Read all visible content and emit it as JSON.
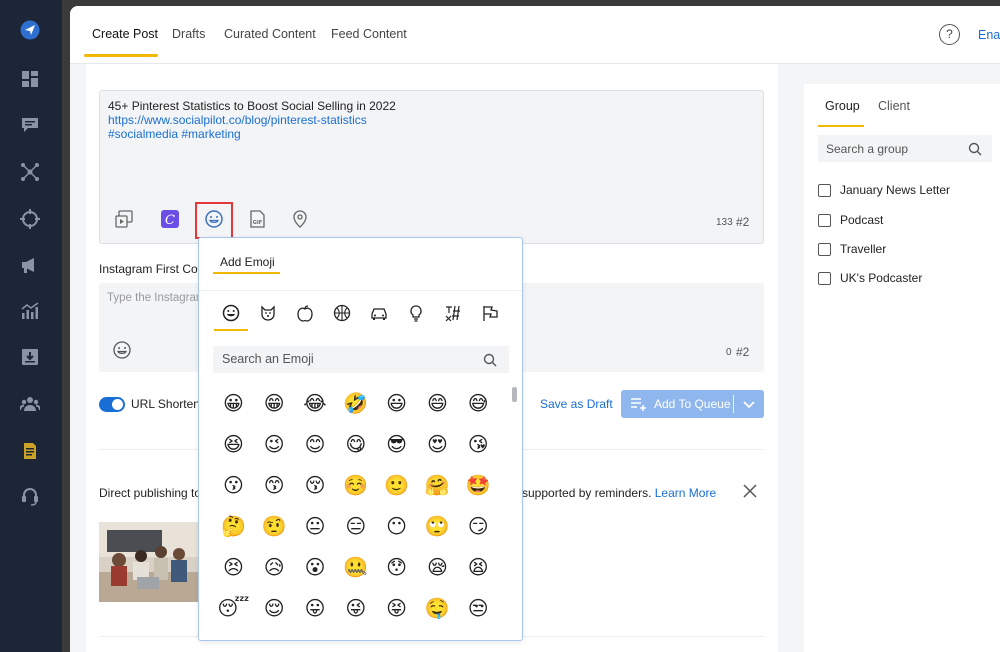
{
  "sidebar": {
    "items": [
      "send-icon",
      "dashboard-icon",
      "messages-icon",
      "connections-icon",
      "crosshair-icon",
      "megaphone-icon",
      "analytics-icon",
      "download-icon",
      "team-icon",
      "document-icon",
      "support-icon"
    ]
  },
  "topnav": {
    "tabs": [
      "Create Post",
      "Drafts",
      "Curated Content",
      "Feed Content"
    ],
    "help": "?",
    "enable": "Enal"
  },
  "editor": {
    "line1": "45+ Pinterest Statistics to Boost Social Selling in 2022",
    "line2": "https://www.socialpilot.co/blog/pinterest-statistics",
    "line3": "#socialmedia #marketing",
    "char_count": "133",
    "hash_count": "#2"
  },
  "instagram": {
    "label": "Instagram First Comment",
    "placeholder": "Type the Instagram first comment",
    "char_count": "0",
    "hash_count": "#2"
  },
  "actions": {
    "url_label": "URL Shortening",
    "save_draft": "Save as Draft",
    "add_queue": "Add To Queue"
  },
  "notice": {
    "left": "Direct publishing to",
    "right": "re supported by reminders.",
    "learn_more": "Learn More"
  },
  "right_panel": {
    "tabs": [
      "Group",
      "Client"
    ],
    "search_placeholder": "Search a group",
    "groups": [
      "January News Letter",
      "Podcast",
      "Traveller",
      "UK's Podcaster"
    ]
  },
  "emoji_popup": {
    "title": "Add Emoji",
    "search_placeholder": "Search an Emoji",
    "categories": [
      "smiley-icon",
      "animal-icon",
      "food-icon",
      "sports-icon",
      "car-icon",
      "bulb-icon",
      "symbols-icon",
      "flags-icon"
    ],
    "rows": [
      [
        "😀",
        "😁",
        "😂",
        "🤣",
        "😃",
        "😄",
        "😅"
      ],
      [
        "😆",
        "😉",
        "😊",
        "😋",
        "😎",
        "😍",
        "😘"
      ],
      [
        "😗",
        "😙",
        "😚",
        "☺️",
        "🙂",
        "🤗",
        "🤩"
      ],
      [
        "🤔",
        "🤨",
        "😐",
        "😑",
        "😶",
        "🙄",
        "😏"
      ],
      [
        "😣",
        "😥",
        "😮",
        "🤐",
        "😯",
        "😪",
        "😫"
      ],
      [
        "😴",
        "😌",
        "😛",
        "😜",
        "😝",
        "🤤",
        "😒"
      ]
    ]
  },
  "colors": {
    "accent": "#f2b807",
    "link": "#1a6fd6",
    "sidebar": "#1c2636",
    "highlight": "#e23a3a"
  }
}
